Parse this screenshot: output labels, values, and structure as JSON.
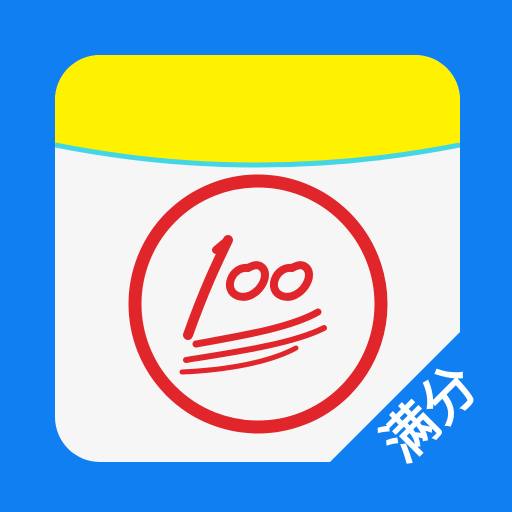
{
  "app_icon": {
    "badge_label": "满分",
    "score_mark_icon": "hundred-points-icon",
    "colors": {
      "background": "#0f7ff2",
      "card": "#f6f6f6",
      "card_header": "#fff200",
      "header_stripe": "#43d6e6",
      "stamp_red": "#e0252b",
      "badge_text": "#ffffff"
    }
  }
}
